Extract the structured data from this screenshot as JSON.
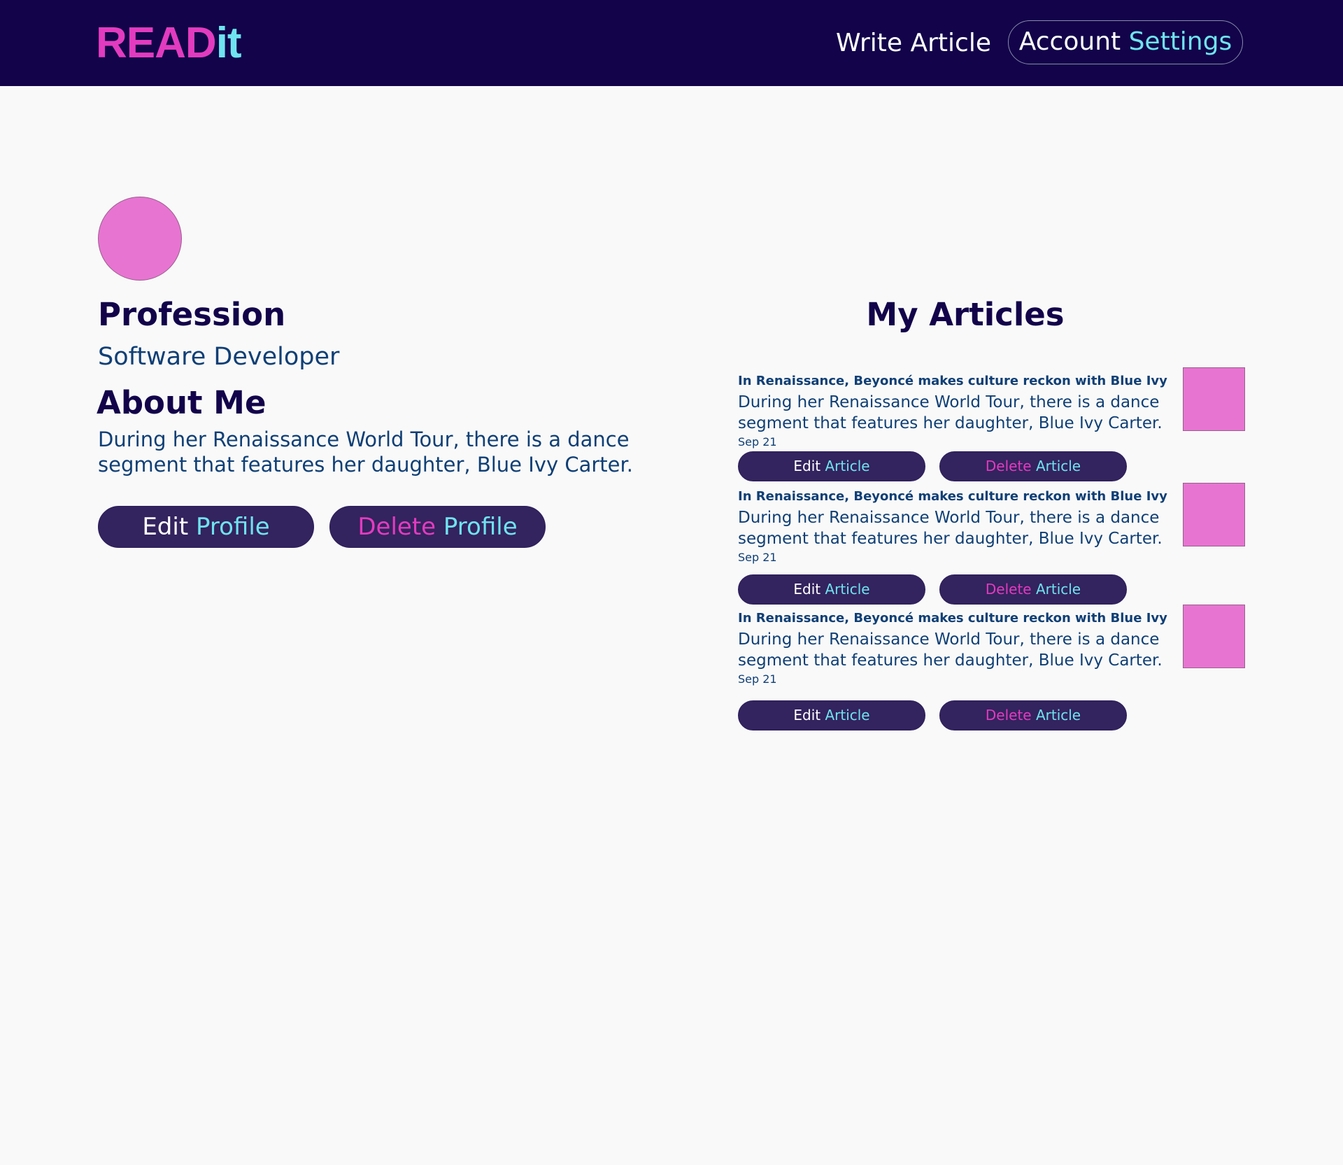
{
  "header": {
    "logo_part1": "READ",
    "logo_part2": "it",
    "write_article": "Write Article",
    "account_part1": "Account",
    "account_part2": "Settings"
  },
  "profile": {
    "profession_heading": "Profession",
    "profession_value": "Software Developer",
    "about_heading": "About Me",
    "about_text": "During her Renaissance World Tour, there is a dance segment that features her daughter, Blue Ivy Carter.",
    "edit_part1": "Edit",
    "edit_part2": "Profile",
    "delete_part1": "Delete",
    "delete_part2": "Profile"
  },
  "articles_heading": "My Articles",
  "article_buttons": {
    "edit_part1": "Edit",
    "edit_part2": "Article",
    "delete_part1": "Delete",
    "delete_part2": "Article"
  },
  "articles": [
    {
      "title": "In Renaissance, Beyoncé makes culture reckon with Blue Ivy",
      "excerpt": "During her Renaissance World Tour, there is a dance segment that features her daughter, Blue Ivy Carter.",
      "date": "Sep 21"
    },
    {
      "title": "In Renaissance, Beyoncé makes culture reckon with Blue Ivy",
      "excerpt": "During her Renaissance World Tour, there is a dance segment that features her daughter, Blue Ivy Carter.",
      "date": "Sep 21"
    },
    {
      "title": "In Renaissance, Beyoncé makes culture reckon with Blue Ivy",
      "excerpt": "During her Renaissance World Tour, there is a dance segment that features her daughter, Blue Ivy Carter.",
      "date": "Sep 21"
    }
  ],
  "colors": {
    "header_bg": "#12034a",
    "brand_pink": "#e23bbf",
    "brand_cyan": "#6fe3ef",
    "button_bg": "#33235e",
    "placeholder_pink": "#e774d1",
    "text_blue": "#0f3f75",
    "page_bg": "#f9f9f9"
  }
}
